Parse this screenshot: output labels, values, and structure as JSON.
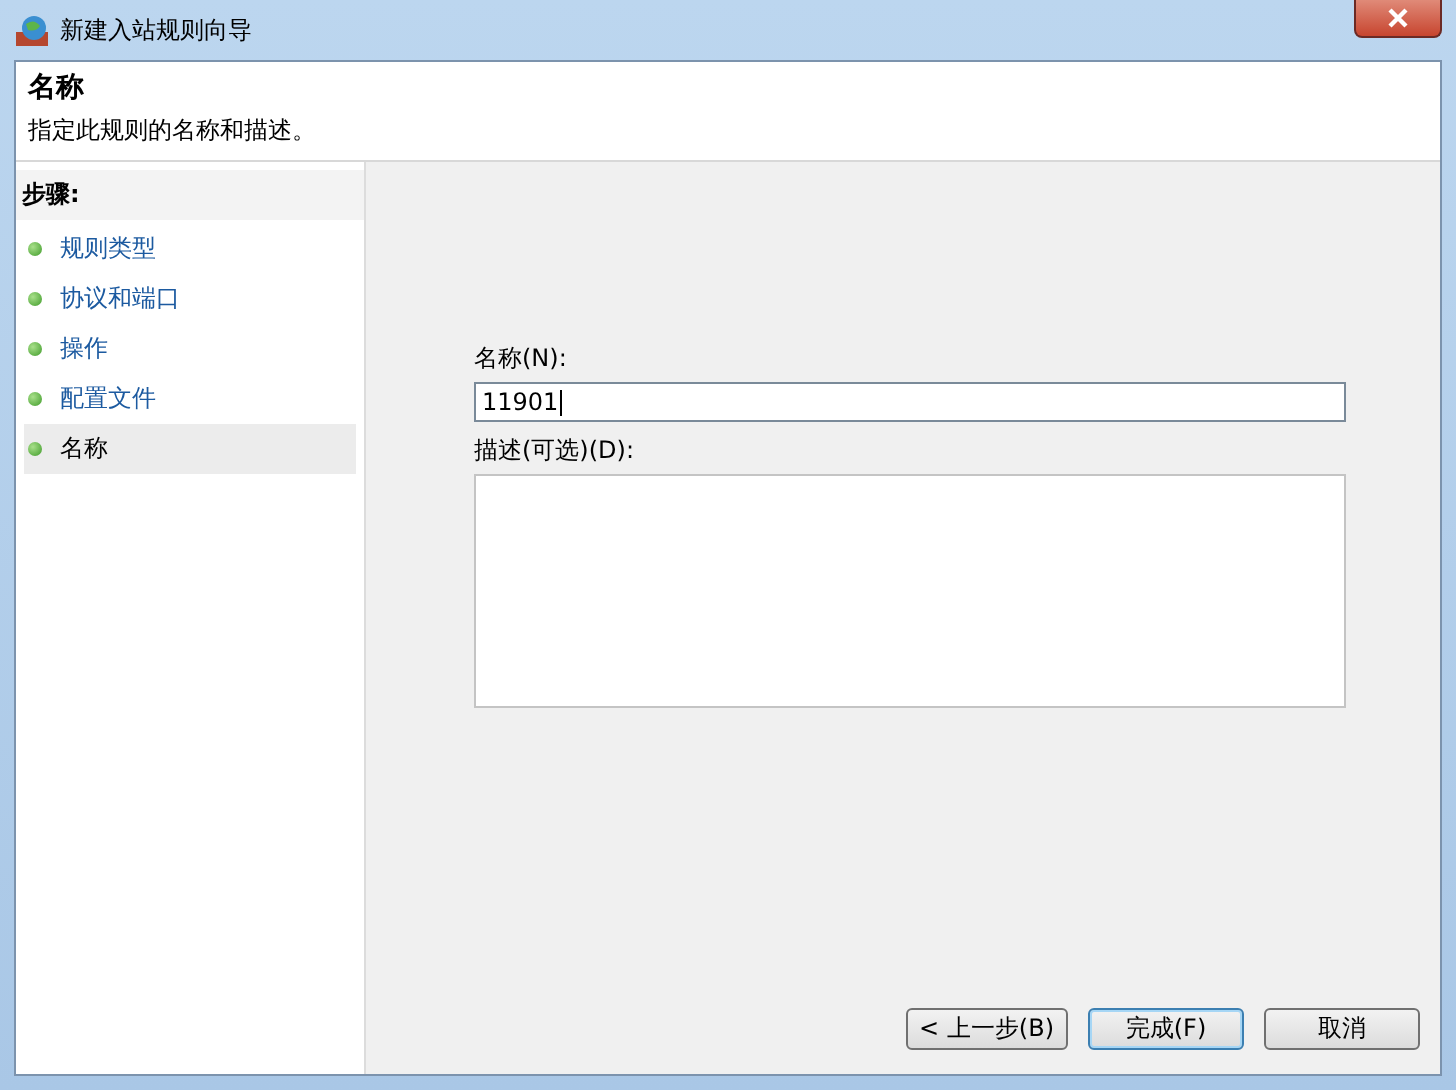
{
  "window": {
    "title": "新建入站规则向导"
  },
  "header": {
    "title": "名称",
    "subtitle": "指定此规则的名称和描述。"
  },
  "steps": {
    "heading": "步骤:",
    "items": [
      {
        "label": "规则类型",
        "selected": false
      },
      {
        "label": "协议和端口",
        "selected": false
      },
      {
        "label": "操作",
        "selected": false
      },
      {
        "label": "配置文件",
        "selected": false
      },
      {
        "label": "名称",
        "selected": true
      }
    ]
  },
  "form": {
    "name_label": "名称(N):",
    "name_value": "11901",
    "description_label": "描述(可选)(D):"
  },
  "buttons": [
    "< 上一步(B)",
    "完成(F)",
    "取消"
  ]
}
